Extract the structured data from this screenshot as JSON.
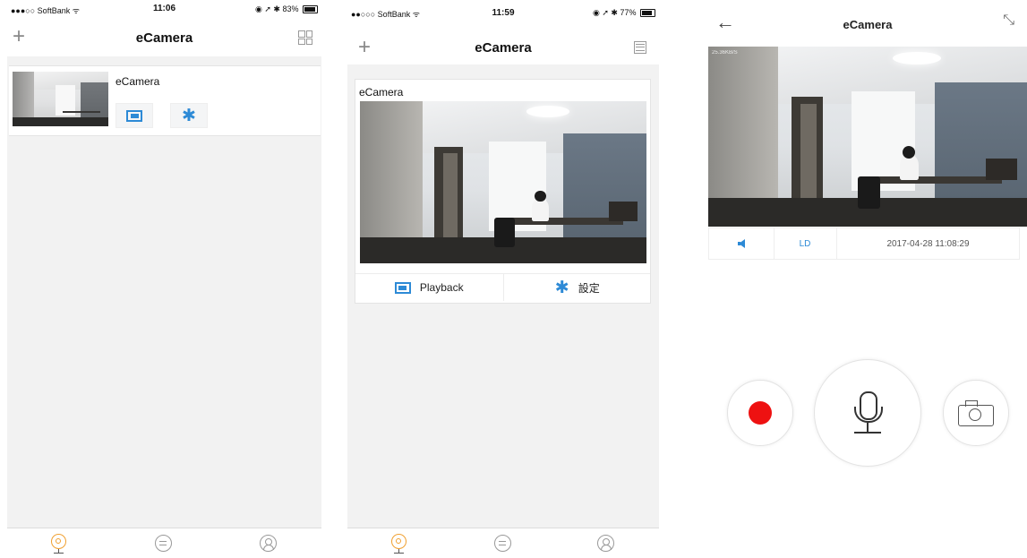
{
  "screen1": {
    "status": {
      "carrier": "●●●○○ SoftBank ᯤ",
      "time": "11:06",
      "right": "◉ ➚ ✱ 83%",
      "battery_percent": 83
    },
    "nav": {
      "title": "eCamera",
      "plus_icon": "plus-icon",
      "right_icon": "grid-view-icon"
    },
    "device": {
      "name": "eCamera"
    },
    "tabs": [
      "camera-tab-icon",
      "message-tab-icon",
      "profile-tab-icon"
    ]
  },
  "screen2": {
    "status": {
      "carrier": "●●○○○ SoftBank ᯤ",
      "time": "11:59",
      "right": "◉ ➚ ✱ 77%",
      "battery_percent": 77
    },
    "nav": {
      "title": "eCamera",
      "plus_icon": "plus-icon",
      "right_icon": "list-view-icon"
    },
    "device": {
      "name": "eCamera",
      "playback_label": "Playback",
      "settings_label": "設定"
    }
  },
  "screen3": {
    "nav": {
      "title": "eCamera",
      "back": "←",
      "expand": "⤡"
    },
    "osd": "25.36KB/S",
    "controls": {
      "quality": "LD",
      "timestamp": "2017-04-28 11:08:29"
    }
  },
  "colors": {
    "accent": "#2d8ad6",
    "tab_active": "#f0a030",
    "record": "#ee1111",
    "background": "#f2f2f2"
  }
}
